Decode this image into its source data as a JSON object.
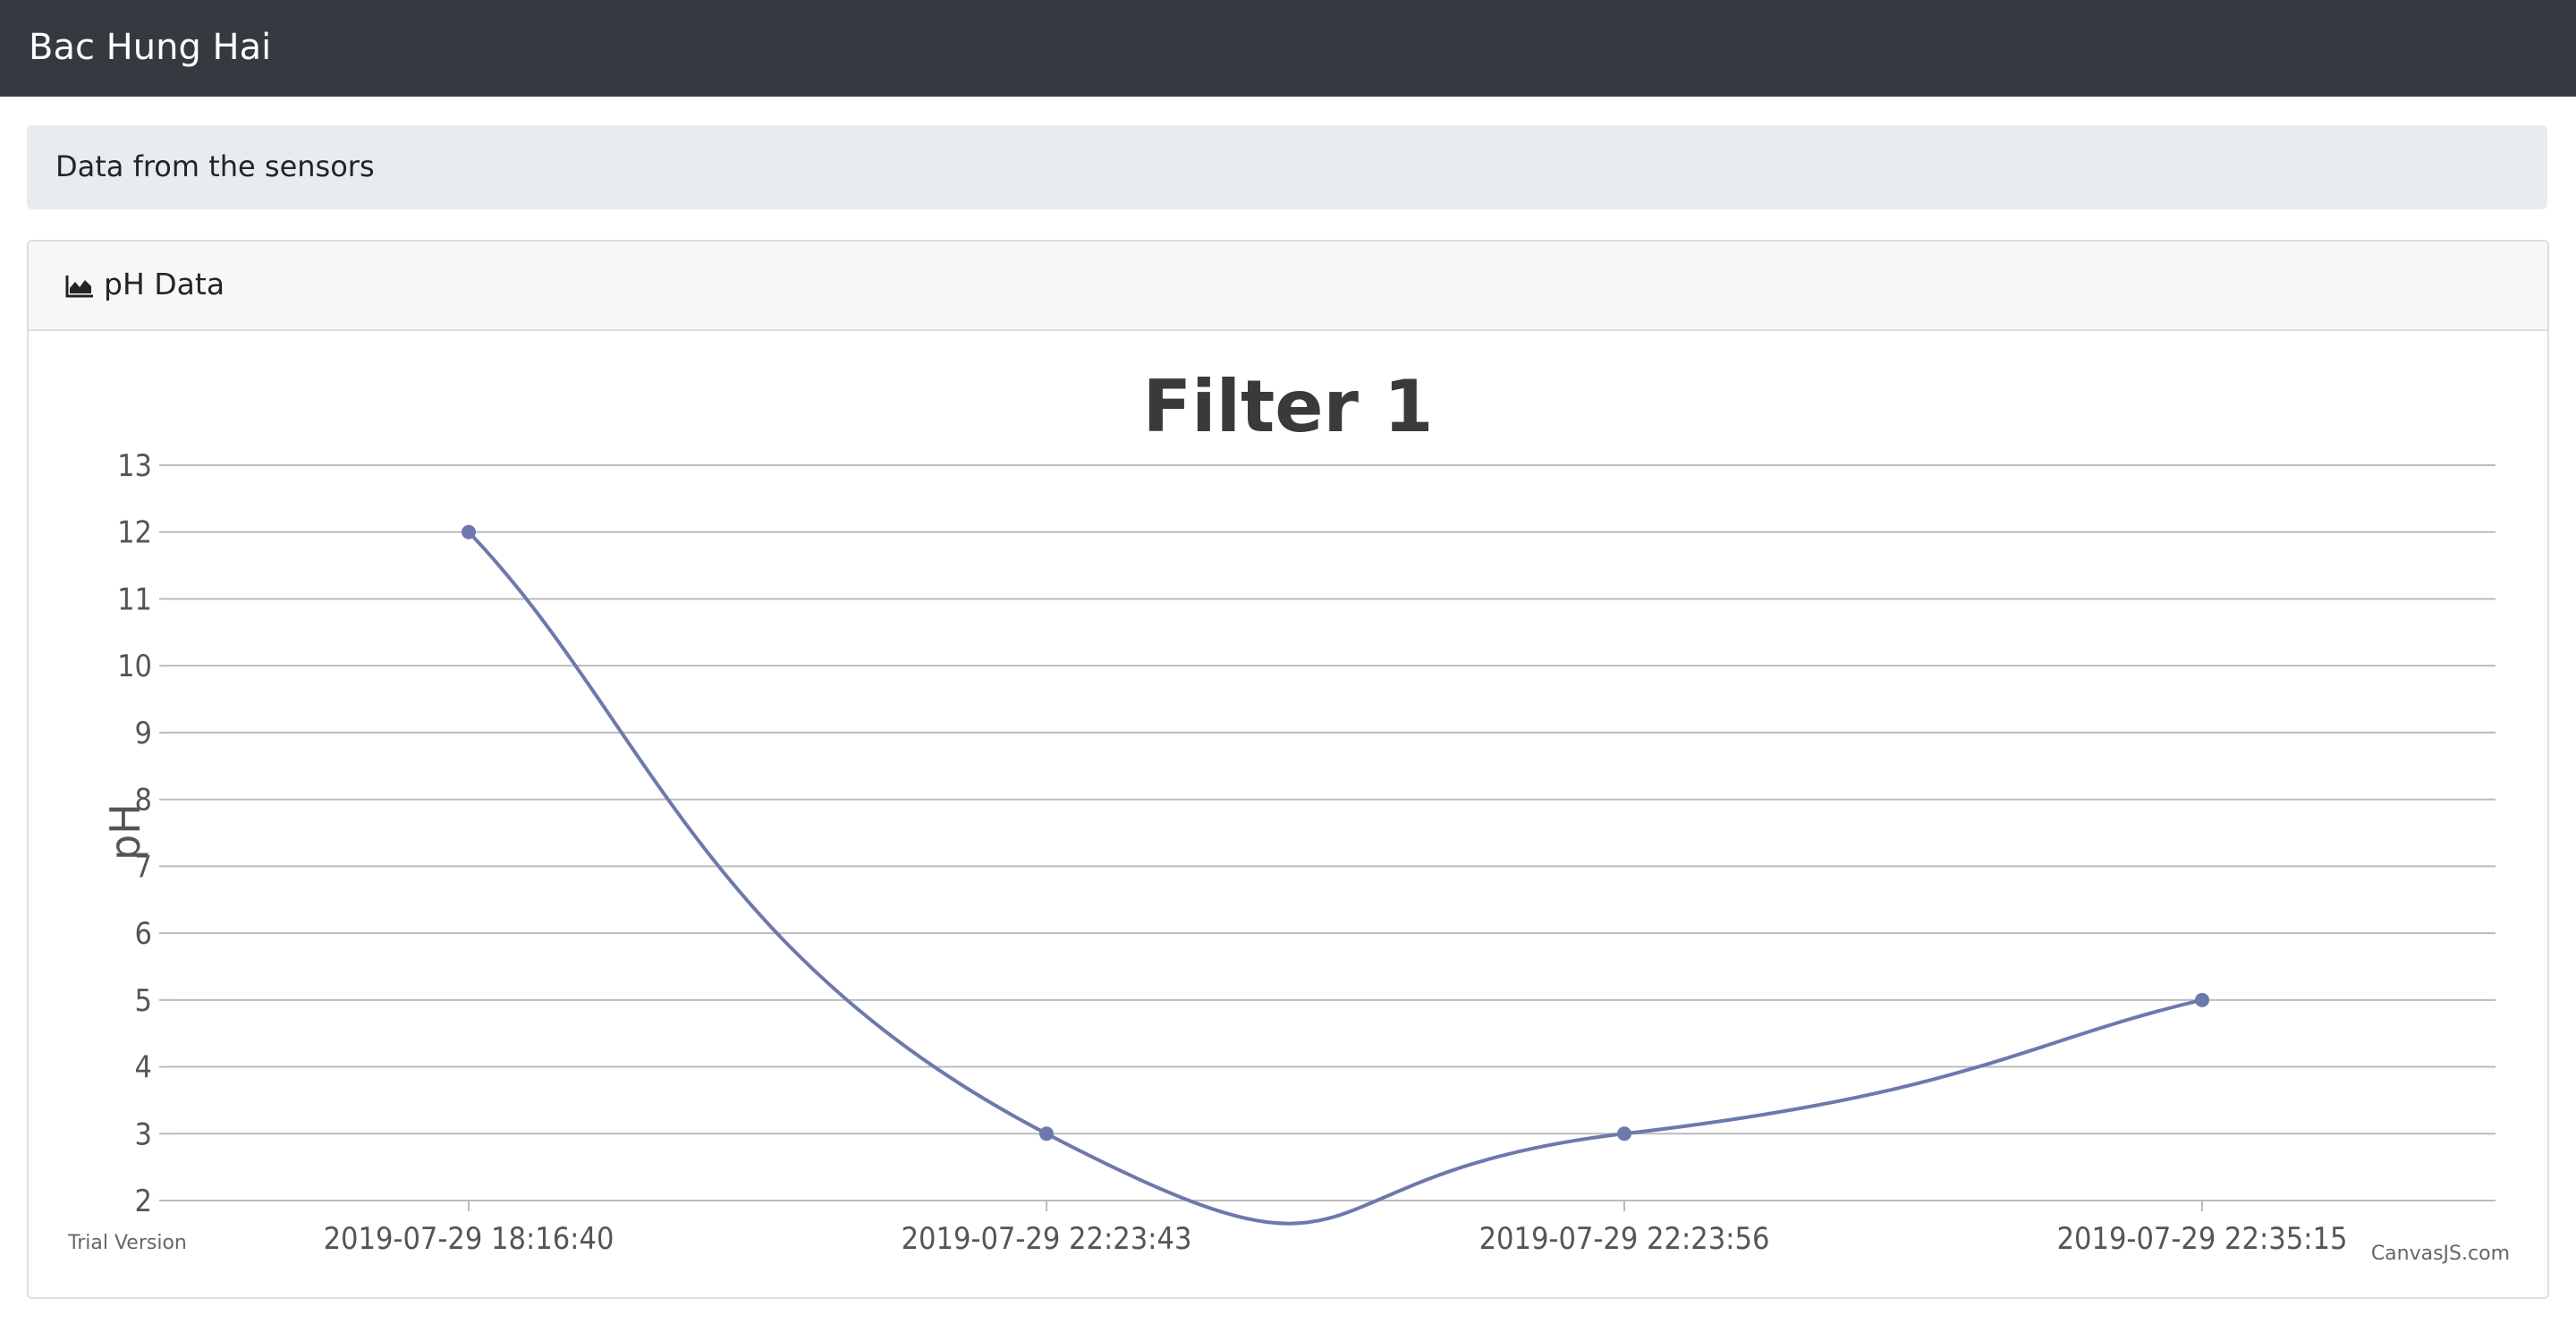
{
  "navbar": {
    "brand": "Bac Hung Hai"
  },
  "breadcrumb": {
    "text": "Data from the sensors"
  },
  "card": {
    "title": "pH Data",
    "icon": "area-chart-icon"
  },
  "chart_data": {
    "type": "line",
    "title": "Filter 1",
    "xlabel": "",
    "ylabel": "pH",
    "x": [
      "2019-07-29 18:16:40",
      "2019-07-29 22:23:43",
      "2019-07-29 22:23:56",
      "2019-07-29 22:35:15"
    ],
    "series": [
      {
        "values": [
          12,
          3,
          3,
          5
        ]
      }
    ],
    "ylim": [
      2,
      13
    ],
    "yticks": [
      2,
      3,
      4,
      5,
      6,
      7,
      8,
      9,
      10,
      11,
      12,
      13
    ],
    "grid": true,
    "smooth": true,
    "series_color": "#6d78ad",
    "watermark_left": "Trial Version",
    "watermark_right": "CanvasJS.com"
  },
  "colors": {
    "navbar_bg": "#343a40",
    "breadcrumb_bg": "#e9ecef",
    "grid": "#bbbbbb"
  }
}
